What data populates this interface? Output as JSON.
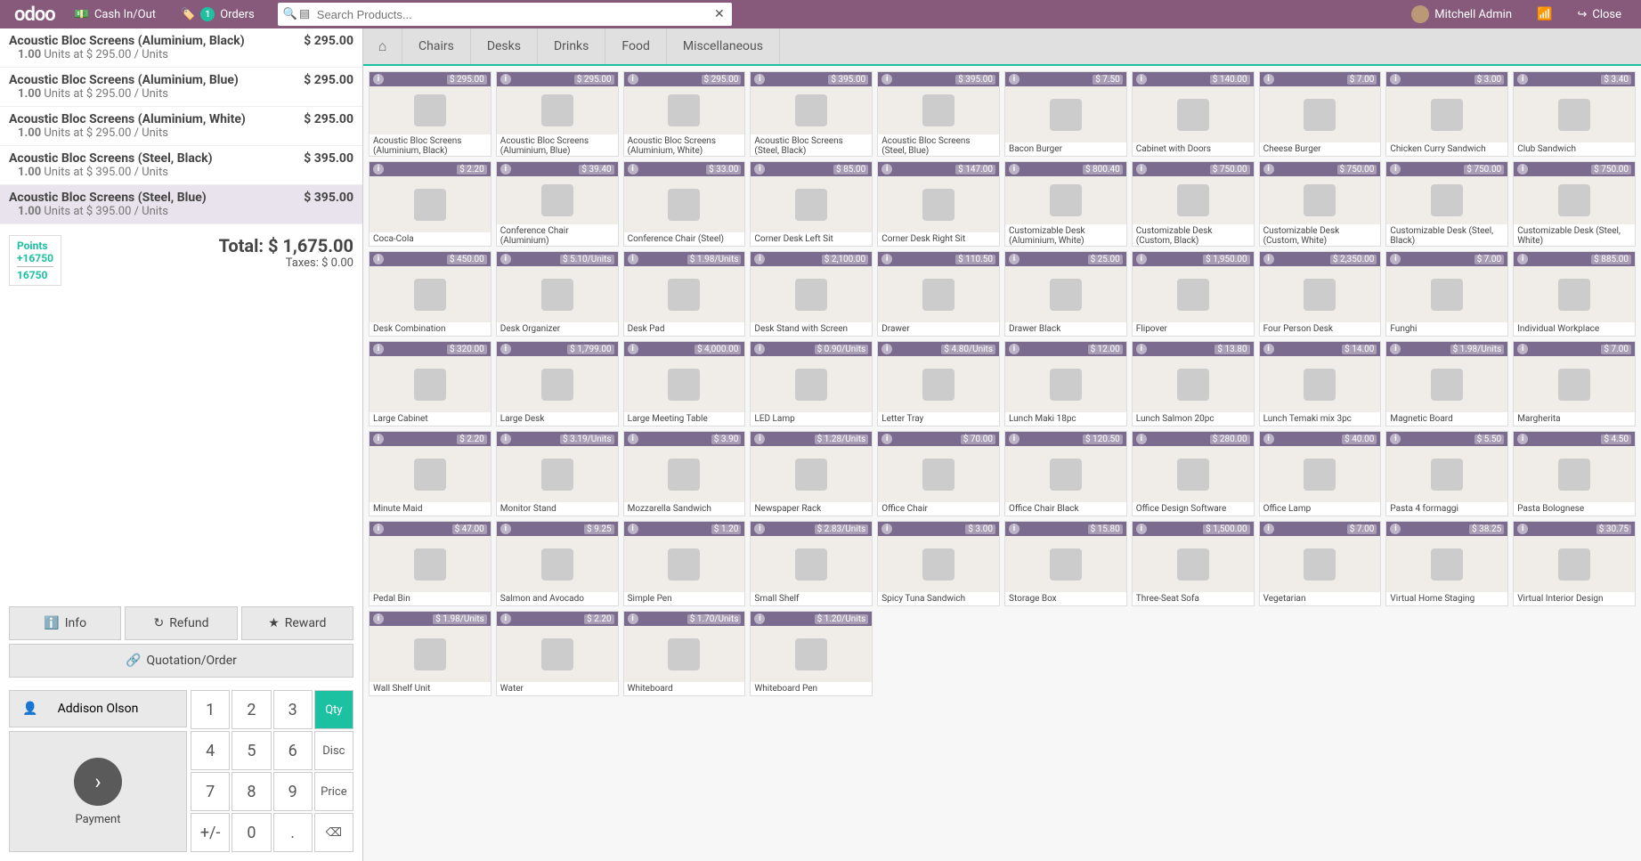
{
  "header": {
    "logo": "odoo",
    "cash": "Cash In/Out",
    "orders": "Orders",
    "orders_badge": "1",
    "search_placeholder": "Search Products...",
    "user": "Mitchell Admin",
    "close": "Close"
  },
  "order_lines": [
    {
      "name": "Acoustic Bloc Screens (Aluminium, Black)",
      "qty": "1.00",
      "uom": "Units",
      "at": "$ 295.00 / Units",
      "price": "$ 295.00",
      "sel": false
    },
    {
      "name": "Acoustic Bloc Screens (Aluminium, Blue)",
      "qty": "1.00",
      "uom": "Units",
      "at": "$ 295.00 / Units",
      "price": "$ 295.00",
      "sel": false
    },
    {
      "name": "Acoustic Bloc Screens (Aluminium, White)",
      "qty": "1.00",
      "uom": "Units",
      "at": "$ 295.00 / Units",
      "price": "$ 295.00",
      "sel": false
    },
    {
      "name": "Acoustic Bloc Screens (Steel, Black)",
      "qty": "1.00",
      "uom": "Units",
      "at": "$ 395.00 / Units",
      "price": "$ 395.00",
      "sel": false
    },
    {
      "name": "Acoustic Bloc Screens (Steel, Blue)",
      "qty": "1.00",
      "uom": "Units",
      "at": "$ 395.00 / Units",
      "price": "$ 395.00",
      "sel": true
    }
  ],
  "points": {
    "label": "Points",
    "earn": "+16750",
    "total": "16750"
  },
  "totals": {
    "total": "Total: $ 1,675.00",
    "taxes": "Taxes: $ 0.00"
  },
  "actions": {
    "info": "Info",
    "refund": "Refund",
    "reward": "Reward",
    "quote": "Quotation/Order"
  },
  "customer": "Addison Olson",
  "payment": "Payment",
  "keypad": {
    "keys": [
      [
        "1",
        "2",
        "3",
        "Qty"
      ],
      [
        "4",
        "5",
        "6",
        "Disc"
      ],
      [
        "7",
        "8",
        "9",
        "Price"
      ],
      [
        "+/-",
        "0",
        ".",
        "⌫"
      ]
    ]
  },
  "categories": [
    "Chairs",
    "Desks",
    "Drinks",
    "Food",
    "Miscellaneous"
  ],
  "products": [
    {
      "name": "Acoustic Bloc Screens (Aluminium, Black)",
      "price": "$ 295.00"
    },
    {
      "name": "Acoustic Bloc Screens (Aluminium, Blue)",
      "price": "$ 295.00"
    },
    {
      "name": "Acoustic Bloc Screens (Aluminium, White)",
      "price": "$ 295.00"
    },
    {
      "name": "Acoustic Bloc Screens (Steel, Black)",
      "price": "$ 395.00"
    },
    {
      "name": "Acoustic Bloc Screens (Steel, Blue)",
      "price": "$ 395.00"
    },
    {
      "name": "Bacon Burger",
      "price": "$ 7.50"
    },
    {
      "name": "Cabinet with Doors",
      "price": "$ 140.00"
    },
    {
      "name": "Cheese Burger",
      "price": "$ 7.00"
    },
    {
      "name": "Chicken Curry Sandwich",
      "price": "$ 3.00"
    },
    {
      "name": "Club Sandwich",
      "price": "$ 3.40"
    },
    {
      "name": "Coca-Cola",
      "price": "$ 2.20"
    },
    {
      "name": "Conference Chair (Aluminium)",
      "price": "$ 39.40"
    },
    {
      "name": "Conference Chair (Steel)",
      "price": "$ 33.00"
    },
    {
      "name": "Corner Desk Left Sit",
      "price": "$ 85.00"
    },
    {
      "name": "Corner Desk Right Sit",
      "price": "$ 147.00"
    },
    {
      "name": "Customizable Desk (Aluminium, White)",
      "price": "$ 800.40"
    },
    {
      "name": "Customizable Desk (Custom, Black)",
      "price": "$ 750.00"
    },
    {
      "name": "Customizable Desk (Custom, White)",
      "price": "$ 750.00"
    },
    {
      "name": "Customizable Desk (Steel, Black)",
      "price": "$ 750.00"
    },
    {
      "name": "Customizable Desk (Steel, White)",
      "price": "$ 750.00"
    },
    {
      "name": "Desk Combination",
      "price": "$ 450.00"
    },
    {
      "name": "Desk Organizer",
      "price": "$ 5.10/Units"
    },
    {
      "name": "Desk Pad",
      "price": "$ 1.98/Units"
    },
    {
      "name": "Desk Stand with Screen",
      "price": "$ 2,100.00"
    },
    {
      "name": "Drawer",
      "price": "$ 110.50"
    },
    {
      "name": "Drawer Black",
      "price": "$ 25.00"
    },
    {
      "name": "Flipover",
      "price": "$ 1,950.00"
    },
    {
      "name": "Four Person Desk",
      "price": "$ 2,350.00"
    },
    {
      "name": "Funghi",
      "price": "$ 7.00"
    },
    {
      "name": "Individual Workplace",
      "price": "$ 885.00"
    },
    {
      "name": "Large Cabinet",
      "price": "$ 320.00"
    },
    {
      "name": "Large Desk",
      "price": "$ 1,799.00"
    },
    {
      "name": "Large Meeting Table",
      "price": "$ 4,000.00"
    },
    {
      "name": "LED Lamp",
      "price": "$ 0.90/Units"
    },
    {
      "name": "Letter Tray",
      "price": "$ 4.80/Units"
    },
    {
      "name": "Lunch Maki 18pc",
      "price": "$ 12.00"
    },
    {
      "name": "Lunch Salmon 20pc",
      "price": "$ 13.80"
    },
    {
      "name": "Lunch Temaki mix 3pc",
      "price": "$ 14.00"
    },
    {
      "name": "Magnetic Board",
      "price": "$ 1.98/Units"
    },
    {
      "name": "Margherita",
      "price": "$ 7.00"
    },
    {
      "name": "Minute Maid",
      "price": "$ 2.20"
    },
    {
      "name": "Monitor Stand",
      "price": "$ 3.19/Units"
    },
    {
      "name": "Mozzarella Sandwich",
      "price": "$ 3.90"
    },
    {
      "name": "Newspaper Rack",
      "price": "$ 1.28/Units"
    },
    {
      "name": "Office Chair",
      "price": "$ 70.00"
    },
    {
      "name": "Office Chair Black",
      "price": "$ 120.50"
    },
    {
      "name": "Office Design Software",
      "price": "$ 280.00"
    },
    {
      "name": "Office Lamp",
      "price": "$ 40.00"
    },
    {
      "name": "Pasta 4 formaggi",
      "price": "$ 5.50"
    },
    {
      "name": "Pasta Bolognese",
      "price": "$ 4.50"
    },
    {
      "name": "Pedal Bin",
      "price": "$ 47.00"
    },
    {
      "name": "Salmon and Avocado",
      "price": "$ 9.25"
    },
    {
      "name": "Simple Pen",
      "price": "$ 1.20"
    },
    {
      "name": "Small Shelf",
      "price": "$ 2.83/Units"
    },
    {
      "name": "Spicy Tuna Sandwich",
      "price": "$ 3.00"
    },
    {
      "name": "Storage Box",
      "price": "$ 15.80"
    },
    {
      "name": "Three-Seat Sofa",
      "price": "$ 1,500.00"
    },
    {
      "name": "Vegetarian",
      "price": "$ 7.00"
    },
    {
      "name": "Virtual Home Staging",
      "price": "$ 38.25"
    },
    {
      "name": "Virtual Interior Design",
      "price": "$ 30.75"
    },
    {
      "name": "Wall Shelf Unit",
      "price": "$ 1.98/Units"
    },
    {
      "name": "Water",
      "price": "$ 2.20"
    },
    {
      "name": "Whiteboard",
      "price": "$ 1.70/Units"
    },
    {
      "name": "Whiteboard Pen",
      "price": "$ 1.20/Units"
    }
  ]
}
